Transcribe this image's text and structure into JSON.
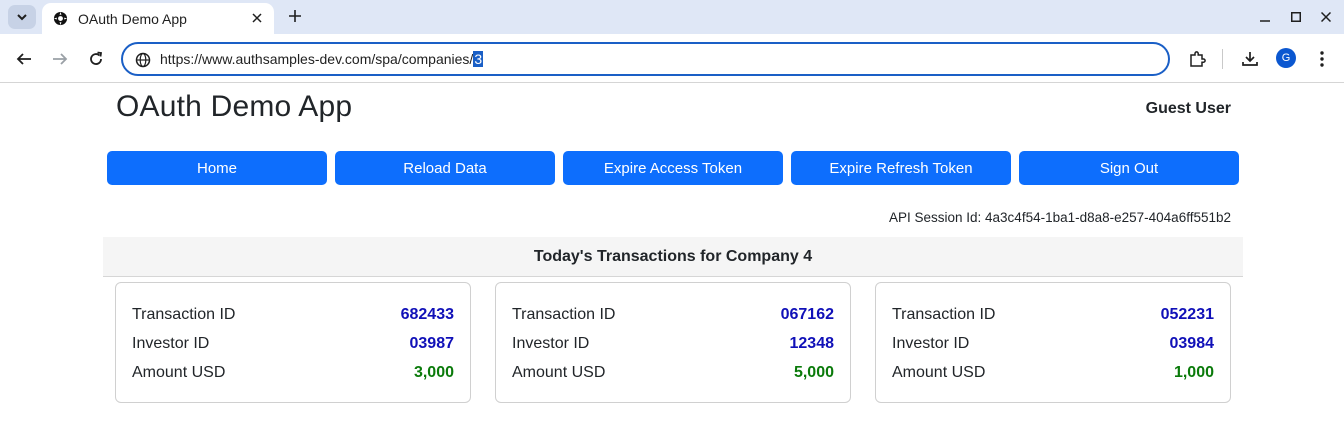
{
  "browser": {
    "tab_title": "OAuth Demo App",
    "url_prefix": "https://www.authsamples-dev.com/spa/companies/",
    "url_selected": "3",
    "avatar_initial": "G"
  },
  "app": {
    "title": "OAuth Demo App",
    "user": "Guest User",
    "nav": [
      "Home",
      "Reload Data",
      "Expire Access Token",
      "Expire Refresh Token",
      "Sign Out"
    ],
    "session_label": "API Session Id: 4a3c4f54-1ba1-d8a8-e257-404a6ff551b2",
    "panel_title": "Today's Transactions for Company 4",
    "labels": {
      "transaction": "Transaction ID",
      "investor": "Investor ID",
      "amount": "Amount USD"
    },
    "transactions": [
      {
        "transaction_id": "682433",
        "investor_id": "03987",
        "amount": "3,000"
      },
      {
        "transaction_id": "067162",
        "investor_id": "12348",
        "amount": "5,000"
      },
      {
        "transaction_id": "052231",
        "investor_id": "03984",
        "amount": "1,000"
      }
    ]
  },
  "colors": {
    "primary": "#0d6efd",
    "link_value": "#1010b8",
    "amount_value": "#0a7a0a",
    "omnibox_border": "#1a5fc6"
  }
}
